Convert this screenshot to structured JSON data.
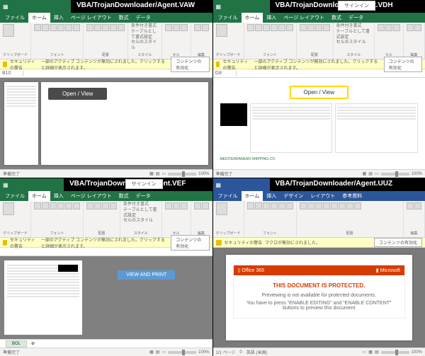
{
  "quadrants": {
    "q1": {
      "overlay": "VBA/TrojanDownloader/Agent.VAW"
    },
    "q2": {
      "overlay": "VBA/TrojanDownloader/Agent.VDH"
    },
    "q3": {
      "overlay": "VBA/TrojanDownloader/Agent.VEF"
    },
    "q4": {
      "overlay": "VBA/TrojanDownloader/Agent.UUZ"
    }
  },
  "common": {
    "signin": "サインイン",
    "file": "ファイル",
    "home": "ホーム",
    "insert": "挿入",
    "pagelayout": "ページ レイアウト",
    "formulas": "数式",
    "data": "データ",
    "design": "デザイン",
    "references": "参考資料",
    "layout": "レイアウト"
  },
  "ribbon": {
    "clipboard": "クリップボード",
    "font": "フォント",
    "alignment": "配置",
    "styles": "スタイル",
    "cells": "セル",
    "editing": "編集",
    "cond_fmt": "条件付き書式",
    "table_fmt": "テーブルとして書式設定",
    "cell_styles": "セルのスタイル"
  },
  "warning": {
    "label": "セキュリティの警告",
    "text_macro": "一部のアクティブ コンテンツが無効にされました。クリックすると詳細が表示されます。",
    "text_macro2": "マクロが無効にされました。",
    "button": "コンテンツの有効化"
  },
  "lure": {
    "open_view": "Open / View",
    "view_print": "VIEW AND PRINT",
    "o365": "Office 365",
    "microsoft": "Microsoft",
    "protected_title": "THIS DOCUMENT IS PROTECTED.",
    "protected_line1": "Previewing is not available for protected documents.",
    "protected_line2": "You have to press \"ENABLE EDITING\" and \"ENABLE CONTENT\" buttons to preview this document",
    "msc": "MEDITERRANEAN SHIPPING CO."
  },
  "cells": {
    "b10": "B10",
    "g8": "G8"
  },
  "sheets": {
    "bol": "BOL"
  },
  "status": {
    "ready": "準備完了",
    "zoom": "100%",
    "page": "1/1 ページ",
    "lang": "英語 (米国)",
    "zero": "0"
  }
}
